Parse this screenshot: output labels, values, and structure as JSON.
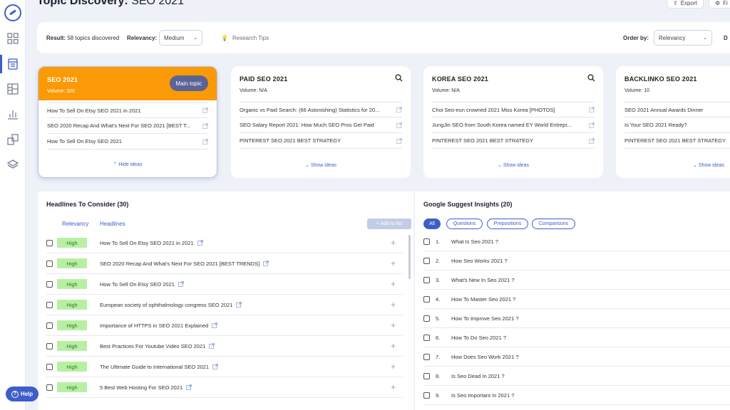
{
  "header": {
    "title_prefix": "Topic Discovery:",
    "title_topic": "SEO 2021",
    "export_label": "Export",
    "more_label": "Fi"
  },
  "filters": {
    "result_label": "Result:",
    "result_value": "58 topics discovered",
    "relevancy_label": "Relevancy:",
    "relevancy_value": "Medium",
    "research_tips": "Research Tips",
    "order_label": "Order by:",
    "order_value": "Relevancy",
    "extra_label": "D"
  },
  "cards": [
    {
      "title": "SEO 2021",
      "volume": "Volume: 320",
      "badge": "Main topic",
      "toggle": "Hide ideas",
      "items": [
        "How To Sell On Etsy SEO 2021 in 2021",
        "SEO 2020 Recap And What's Next For SEO 2021 [BEST T...",
        "How To Sell On Etsy SEO 2021"
      ]
    },
    {
      "title": "PAID SEO 2021",
      "volume": "Volume: N/A",
      "toggle": "Show ideas",
      "items": [
        "Organic vs Paid Search: (66 Astonishing) Statistics for 20...",
        "SEO Salary Report 2021: How Much SEO Pros Get Paid",
        "PINTEREST SEO 2021 BEST STRATEGY"
      ]
    },
    {
      "title": "KOREA SEO 2021",
      "volume": "Volume: N/A",
      "toggle": "Show ideas",
      "items": [
        "Choi Seo-eun crowned 2021 Miss Korea [PHOTOS]",
        "JungJin SEO from South Korea named EY World Entrepr...",
        "PINTEREST SEO 2021 BEST STRATEGY"
      ]
    },
    {
      "title": "BACKLINKO SEO 2021",
      "volume": "Volume: 10",
      "toggle": "Show ideas",
      "items": [
        "SEO 2021 Annual Awards Dinner",
        "Is Your SEO 2021 Ready?",
        "PINTEREST SEO 2021 BEST STRATEGY"
      ]
    }
  ],
  "headlines": {
    "title": "Headlines To Consider (30)",
    "col_relevancy": "Relevancy",
    "col_headlines": "Headlines",
    "add_label": "+ Add to list",
    "rows": [
      {
        "relevancy": "High",
        "text": "How To Sell On Etsy SEO 2021 in 2021"
      },
      {
        "relevancy": "High",
        "text": "SEO 2020 Recap And What's Next For SEO 2021 [BEST TRENDS]"
      },
      {
        "relevancy": "High",
        "text": "How To Sell On Etsy SEO 2021"
      },
      {
        "relevancy": "High",
        "text": "European society of ophthalmology congress SEO 2021"
      },
      {
        "relevancy": "High",
        "text": "Importance of HTTPS in SEO 2021 Explained"
      },
      {
        "relevancy": "High",
        "text": "Best Practices For Youtube Video SEO 2021"
      },
      {
        "relevancy": "High",
        "text": "The Ultimate Guide to International SEO 2021"
      },
      {
        "relevancy": "High",
        "text": "5 Best Web Hosting For SEO 2021"
      }
    ]
  },
  "suggest": {
    "title": "Google Suggest Insights (20)",
    "chips": [
      "All",
      "Questions",
      "Prepositions",
      "Comparisons"
    ],
    "rows": [
      {
        "num": "1.",
        "text": "What Is Seo 2021 ?"
      },
      {
        "num": "2.",
        "text": "How Seo Works 2021 ?"
      },
      {
        "num": "3.",
        "text": "What's New In Seo 2021 ?"
      },
      {
        "num": "4.",
        "text": "How To Master Seo 2021 ?"
      },
      {
        "num": "5.",
        "text": "How To Improve Seo 2021 ?"
      },
      {
        "num": "6.",
        "text": "How To Do Seo 2021 ?"
      },
      {
        "num": "7.",
        "text": "How Does Seo Work 2021 ?"
      },
      {
        "num": "8.",
        "text": "Is Seo Dead In 2021 ?"
      },
      {
        "num": "9.",
        "text": "Is Seo Important In 2021 ?"
      }
    ]
  },
  "help_label": "Help",
  "colors": {
    "accent": "#3d5ec9",
    "main_topic": "#f99a06",
    "high_pill": "#b8f0a3"
  }
}
